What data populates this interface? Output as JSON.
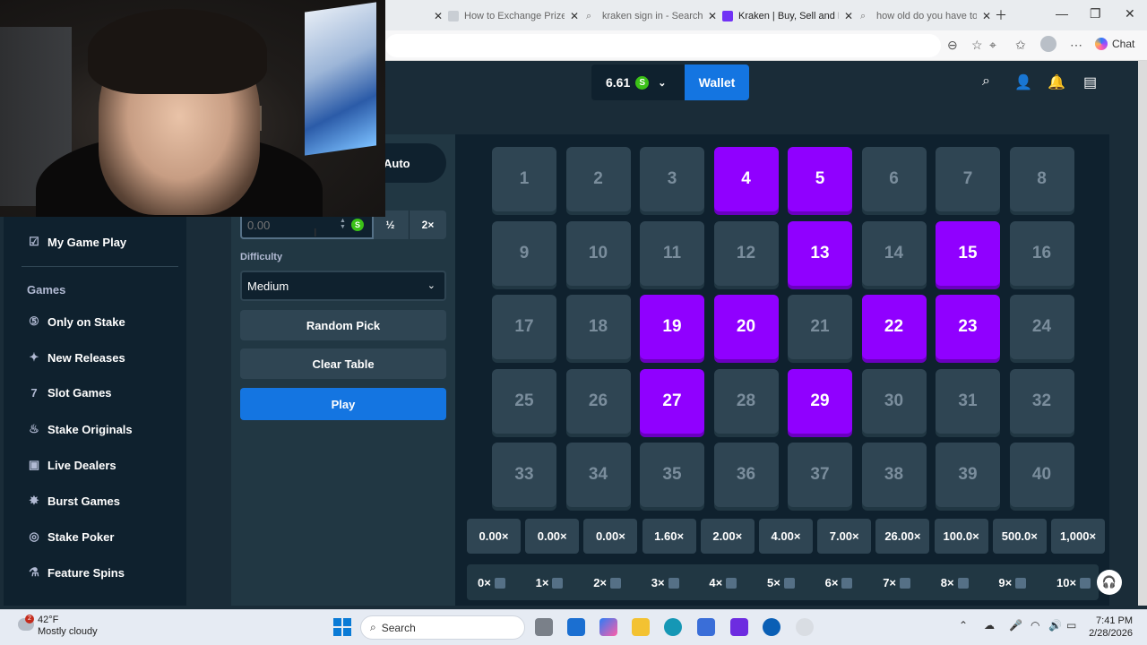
{
  "browser": {
    "tabs": [
      {
        "label": "How to Exchange Prize",
        "color": "#9aa0a6",
        "icon": "document-icon"
      },
      {
        "label": "kraken sign in - Search",
        "color": "#9aa0a6",
        "icon": "search-icon"
      },
      {
        "label": "Kraken | Buy, Sell and M",
        "color": "#7132f5",
        "icon": "kraken-icon"
      },
      {
        "label": "how old do you have to",
        "color": "#9aa0a6",
        "icon": "search-icon"
      }
    ],
    "chat_label": "Chat"
  },
  "header": {
    "balance": "6.61",
    "currency_symbol": "S",
    "wallet_label": "Wallet"
  },
  "sidebar": {
    "top_item": "My Game Play",
    "games_heading": "Games",
    "items": [
      {
        "label": "Only on Stake",
        "icon": "stake-icon"
      },
      {
        "label": "New Releases",
        "icon": "sparkle-icon"
      },
      {
        "label": "Slot Games",
        "icon": "slot-icon"
      },
      {
        "label": "Stake Originals",
        "icon": "fire-icon"
      },
      {
        "label": "Live Dealers",
        "icon": "live-icon"
      },
      {
        "label": "Burst Games",
        "icon": "burst-icon"
      },
      {
        "label": "Stake Poker",
        "icon": "poker-icon"
      },
      {
        "label": "Feature Spins",
        "icon": "flask-icon"
      }
    ]
  },
  "controls": {
    "auto_tab": "Auto",
    "bet_value": "0.00",
    "half_label": "½",
    "double_label": "2×",
    "difficulty_label": "Difficulty",
    "difficulty_value": "Medium",
    "random_pick": "Random Pick",
    "clear_table": "Clear Table",
    "play": "Play"
  },
  "board": {
    "selected": [
      4,
      5,
      13,
      15,
      19,
      20,
      22,
      23,
      27,
      29
    ],
    "tiles": [
      "1",
      "2",
      "3",
      "4",
      "5",
      "6",
      "7",
      "8",
      "9",
      "10",
      "11",
      "12",
      "13",
      "14",
      "15",
      "16",
      "17",
      "18",
      "19",
      "20",
      "21",
      "22",
      "23",
      "24",
      "25",
      "26",
      "27",
      "28",
      "29",
      "30",
      "31",
      "32",
      "33",
      "34",
      "35",
      "36",
      "37",
      "38",
      "39",
      "40"
    ]
  },
  "multipliers": [
    "0.00×",
    "0.00×",
    "0.00×",
    "1.60×",
    "2.00×",
    "4.00×",
    "7.00×",
    "26.00×",
    "100.0×",
    "500.0×",
    "1,000×"
  ],
  "hits": [
    "0×",
    "1×",
    "2×",
    "3×",
    "4×",
    "5×",
    "6×",
    "7×",
    "8×",
    "9×",
    "10×"
  ],
  "taskbar": {
    "temp": "42°F",
    "weather": "Mostly cloudy",
    "search": "Search",
    "time": "7:41 PM",
    "date": "2/28/2026",
    "notif_count": "2"
  },
  "colors": {
    "selected_tile": "#9000ff",
    "accent_blue": "#1475e1",
    "coin_green": "#3bc117"
  }
}
